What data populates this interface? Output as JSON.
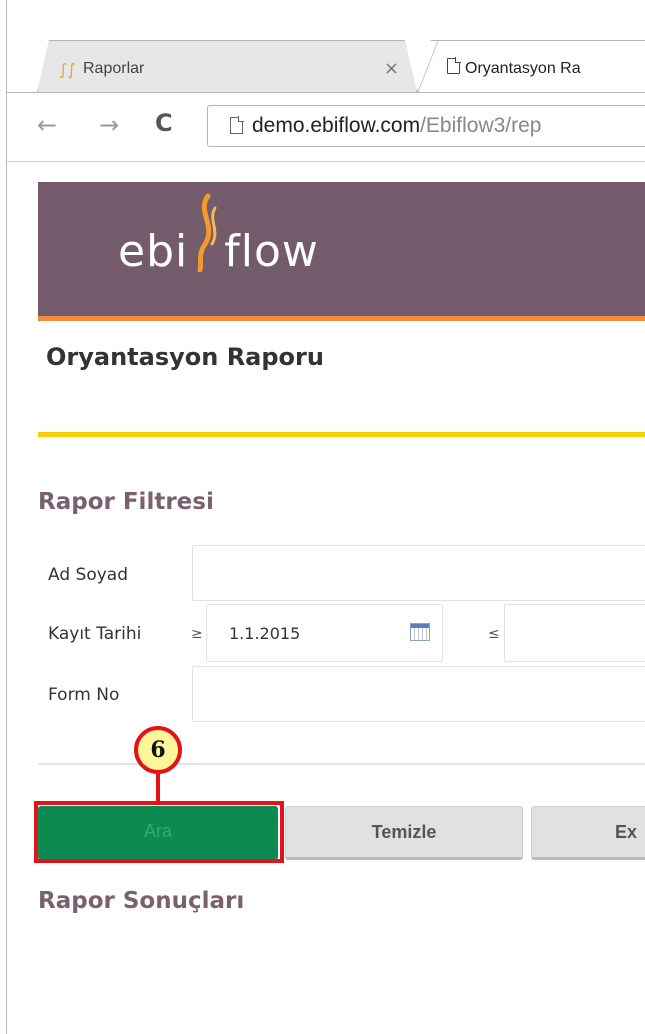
{
  "browser": {
    "tabs": [
      {
        "label": "Raporlar",
        "active": false,
        "icon": "ebiflow-favicon"
      },
      {
        "label": "Oryantasyon Ra",
        "active": true,
        "icon": "page-icon"
      }
    ],
    "close_glyph": "×",
    "nav": {
      "back": "←",
      "forward": "→",
      "reload": "C"
    },
    "url_host": "demo.ebiflow.com",
    "url_path": "/Ebiflow3/rep"
  },
  "page": {
    "logo_left": "ebi",
    "logo_right": "flow",
    "title": "Oryantasyon Raporu",
    "filter_section": "Rapor Filtresi",
    "fields": {
      "ad_soyad_label": "Ad Soyad",
      "ad_soyad_value": "",
      "kayit_tarihi_label": "Kayıt Tarihi",
      "ge_symbol": "≥",
      "date_from": "1.1.2015",
      "le_symbol": "≤",
      "date_to": "",
      "form_no_label": "Form No",
      "form_no_value": ""
    },
    "buttons": {
      "search": "Ara",
      "clear": "Temizle",
      "export": "Ex"
    },
    "results_section": "Rapor Sonuçları"
  },
  "annotation": {
    "step_number": "6",
    "highlight_color": "#e3131a",
    "badge_color": "#fdf59a"
  },
  "colors": {
    "banner": "#735b6b",
    "banner_stripe": "#f2893b",
    "title_underline": "#f5cf06",
    "section_title": "#7a6170",
    "search_button": "#0b8a52"
  }
}
